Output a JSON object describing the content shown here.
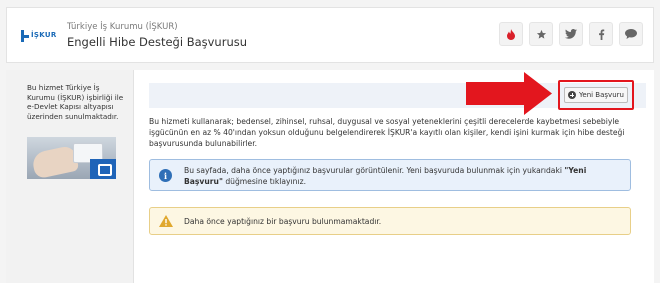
{
  "header": {
    "logo_text": "İŞKUR",
    "subtitle": "Türkiye İş Kurumu (İŞKUR)",
    "title": "Engelli Hibe Desteği Başvurusu",
    "icons": [
      "fire-icon",
      "star-icon",
      "twitter-icon",
      "facebook-icon",
      "comment-icon"
    ]
  },
  "sidebar": {
    "description": "Bu hizmet Türkiye İş Kurumu (İŞKUR) işbirliği ile e-Devlet Kapısı altyapısı üzerinden sunulmaktadır."
  },
  "main": {
    "new_button_label": "Yeni Başvuru",
    "description": "Bu hizmeti kullanarak; bedensel, zihinsel, ruhsal, duygusal ve sosyal yeteneklerini çeşitli derecelerde kaybetmesi sebebiyle işgücünün en az % 40'ından yoksun olduğunu belgelendirerek İŞKUR'a kayıtlı olan kişiler, kendi işini kurmak için hibe desteği başvurusunda bulunabilirler.",
    "info": {
      "text_before": "Bu sayfada, daha önce yaptığınız başvurular görüntülenir. Yeni başvuruda bulunmak için yukarıdaki ",
      "highlight": "\"Yeni Başvuru\"",
      "text_after": " düğmesine tıklayınız."
    },
    "warning": "Daha önce yaptığınız bir başvuru bulunmamaktadır."
  },
  "colors": {
    "accent_blue": "#1a6ab7",
    "highlight_red": "#e3161e",
    "info_bg": "#e9f1fb",
    "warning_bg": "#fdf7e3"
  }
}
